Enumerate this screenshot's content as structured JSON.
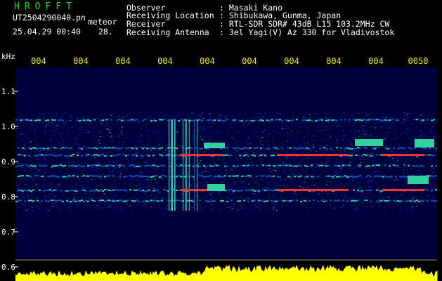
{
  "header": {
    "logo": "HROFFT",
    "filename": "UT2504290040.pn",
    "mode": "meteor",
    "datetime": "25.04.29 00:40",
    "count": "28.",
    "observer_label": "Observer",
    "observer_value": ": Masaki Kano",
    "location_label": "Receiving Location",
    "location_value": ": Shibukawa, Gunma, Japan",
    "receiver_label": "Receiver",
    "receiver_value": ": RTL-SDR SDR# 43dB L15 103.2MHz CW",
    "antenna_label": "Receiving Antenna",
    "antenna_value": ": 3el Yagi(V) Az 330 for Vladivostok"
  },
  "axes": {
    "y_unit": "kHz",
    "y_ticks": [
      "1.1",
      "1.0",
      "0.9",
      "0.8",
      "0.7",
      "0.6"
    ],
    "x_ticks": [
      "004",
      "004",
      "004",
      "004",
      "004",
      "004",
      "004",
      "004",
      "004",
      "0050"
    ]
  },
  "colors": {
    "background": "#000000",
    "plot_background": "#00003c",
    "signal_low": "#1050c0",
    "signal_mid": "#30d0a0",
    "signal_high": "#ff3030",
    "power_trace": "#ffff00",
    "tick_text": "#f0f000"
  },
  "spectrum": {
    "signal_bands_khz": [
      1.02,
      0.94,
      0.92,
      0.89,
      0.86,
      0.82,
      0.79
    ],
    "meteor_times": [
      0.44,
      0.67,
      0.74,
      0.92
    ]
  }
}
